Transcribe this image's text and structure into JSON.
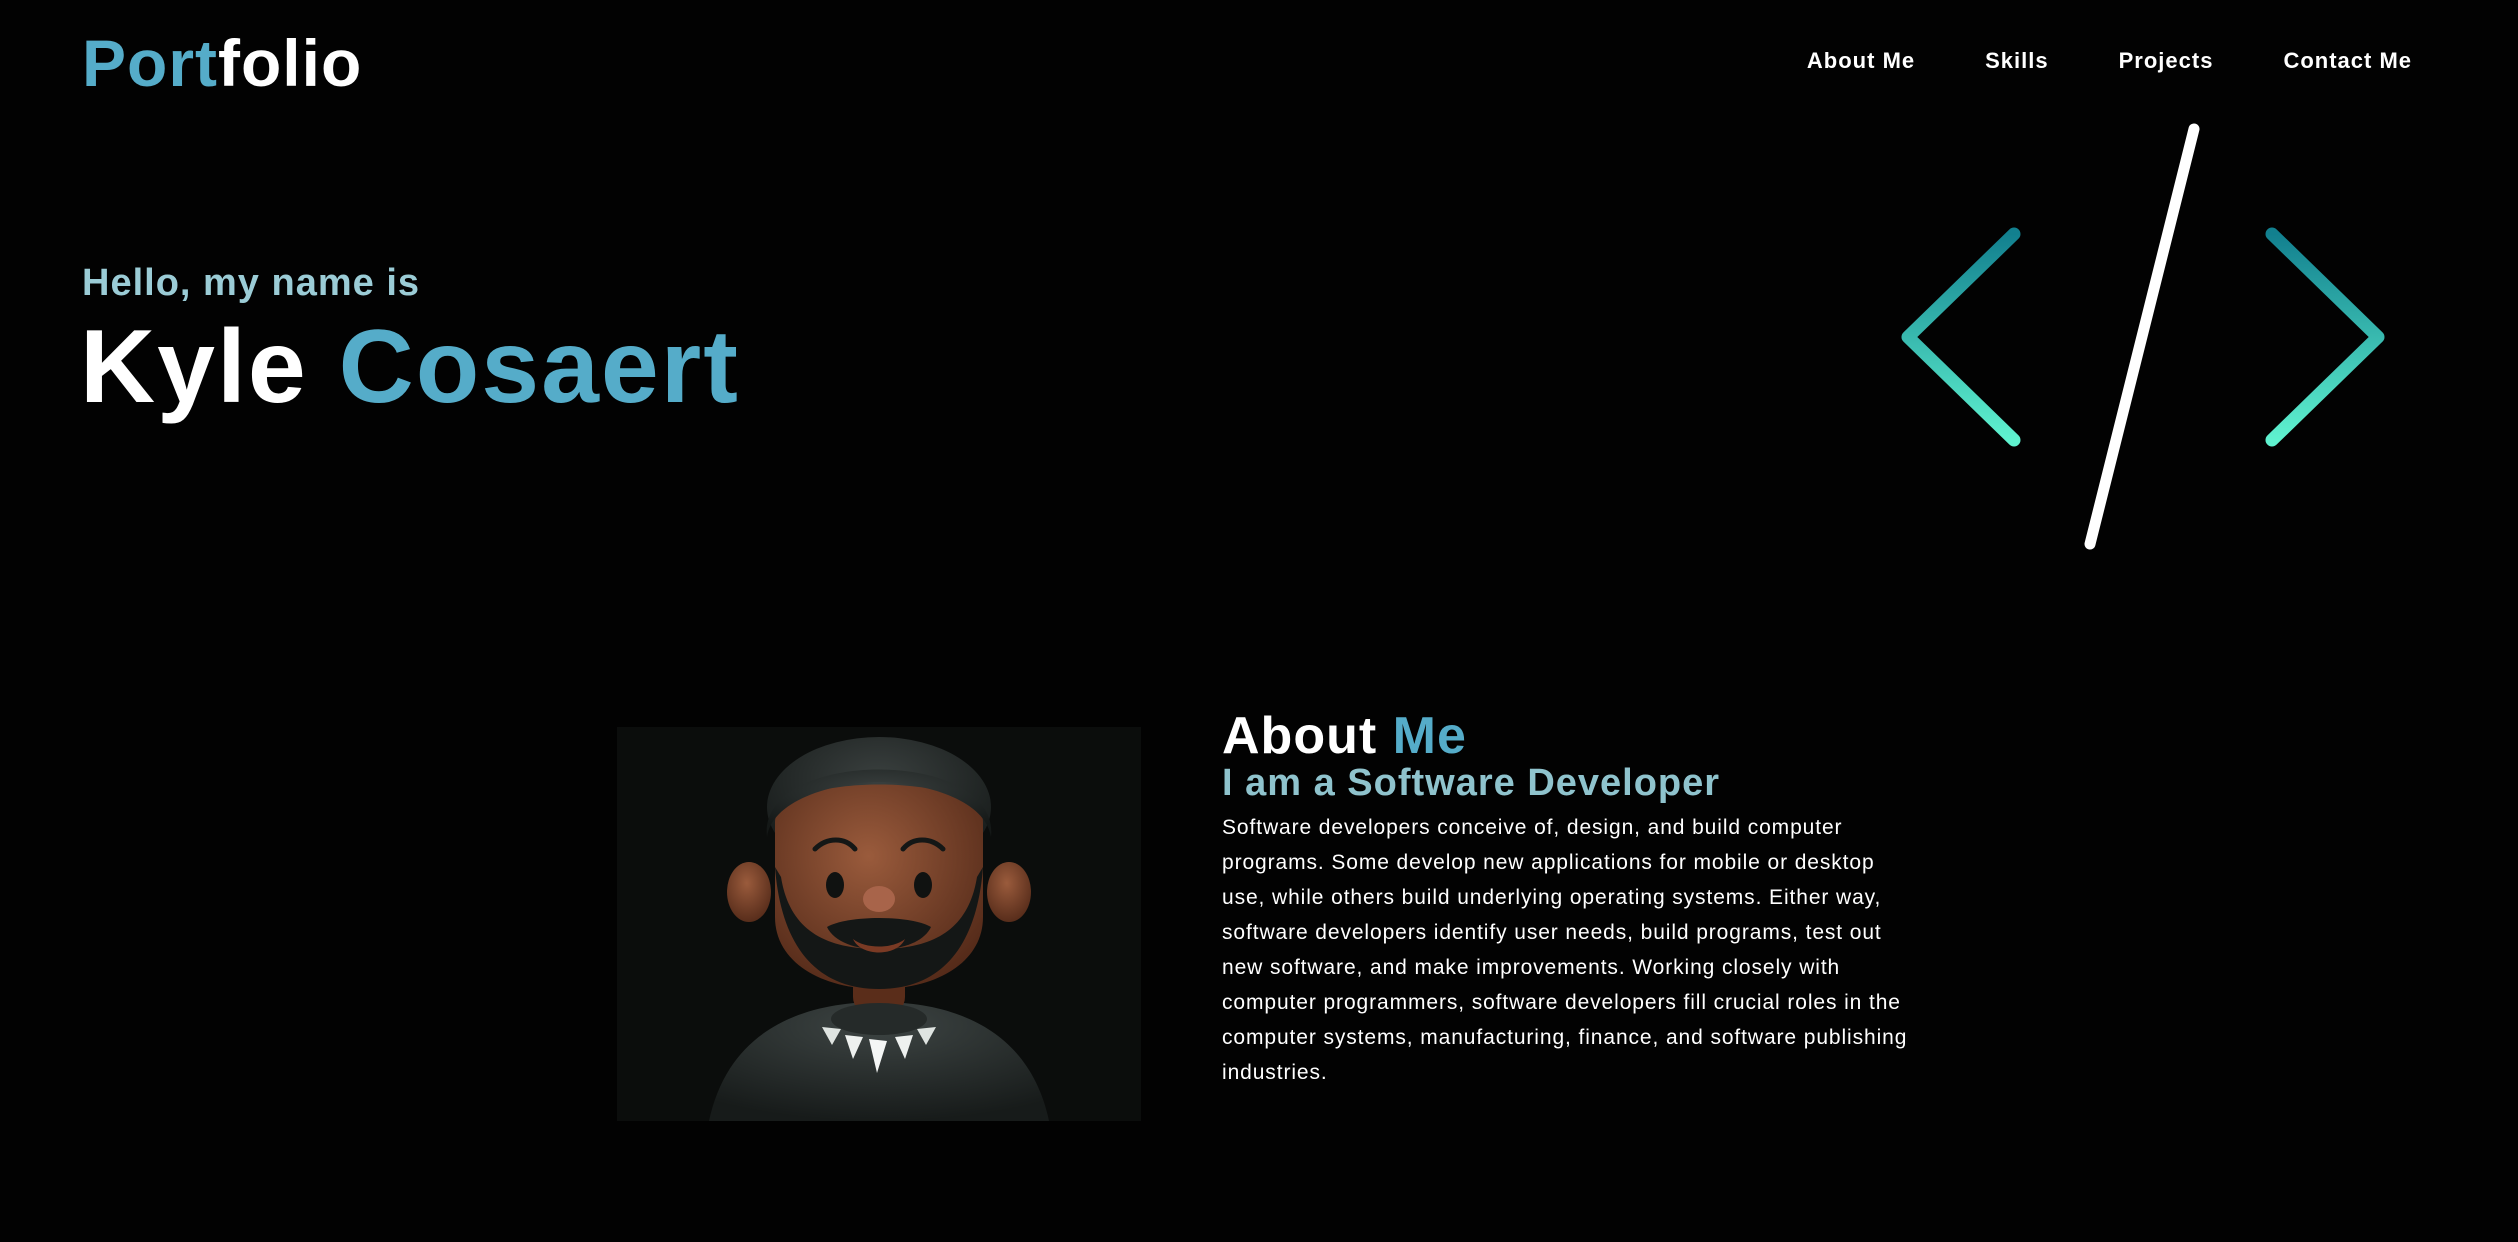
{
  "header": {
    "logo_part1": "Port",
    "logo_part2": "folio",
    "nav": [
      "About Me",
      "Skills",
      "Projects",
      "Contact Me"
    ]
  },
  "hero": {
    "greeting": "Hello, my name is",
    "first_name": "Kyle",
    "last_name": "Cosaert",
    "graphic": "code-brackets-icon"
  },
  "about": {
    "title_part1": "About",
    "title_part2": "Me",
    "subtitle": "I am a Software Developer",
    "body": "Software developers conceive of, design, and build computer programs. Some develop new applications for mobile or desktop use, while others build underlying operating systems. Either way, software developers identify user needs, build programs, test out new software, and make improvements. Working closely with computer programmers, software developers fill crucial roles in the computer systems, manufacturing, finance, and software publishing industries.",
    "image": "avatar-illustration"
  },
  "colors": {
    "background": "#020202",
    "accent": "#55acc9",
    "accent_light": "#9bccd6",
    "teal_dark": "#12808f",
    "teal_light": "#5ff2cf"
  }
}
